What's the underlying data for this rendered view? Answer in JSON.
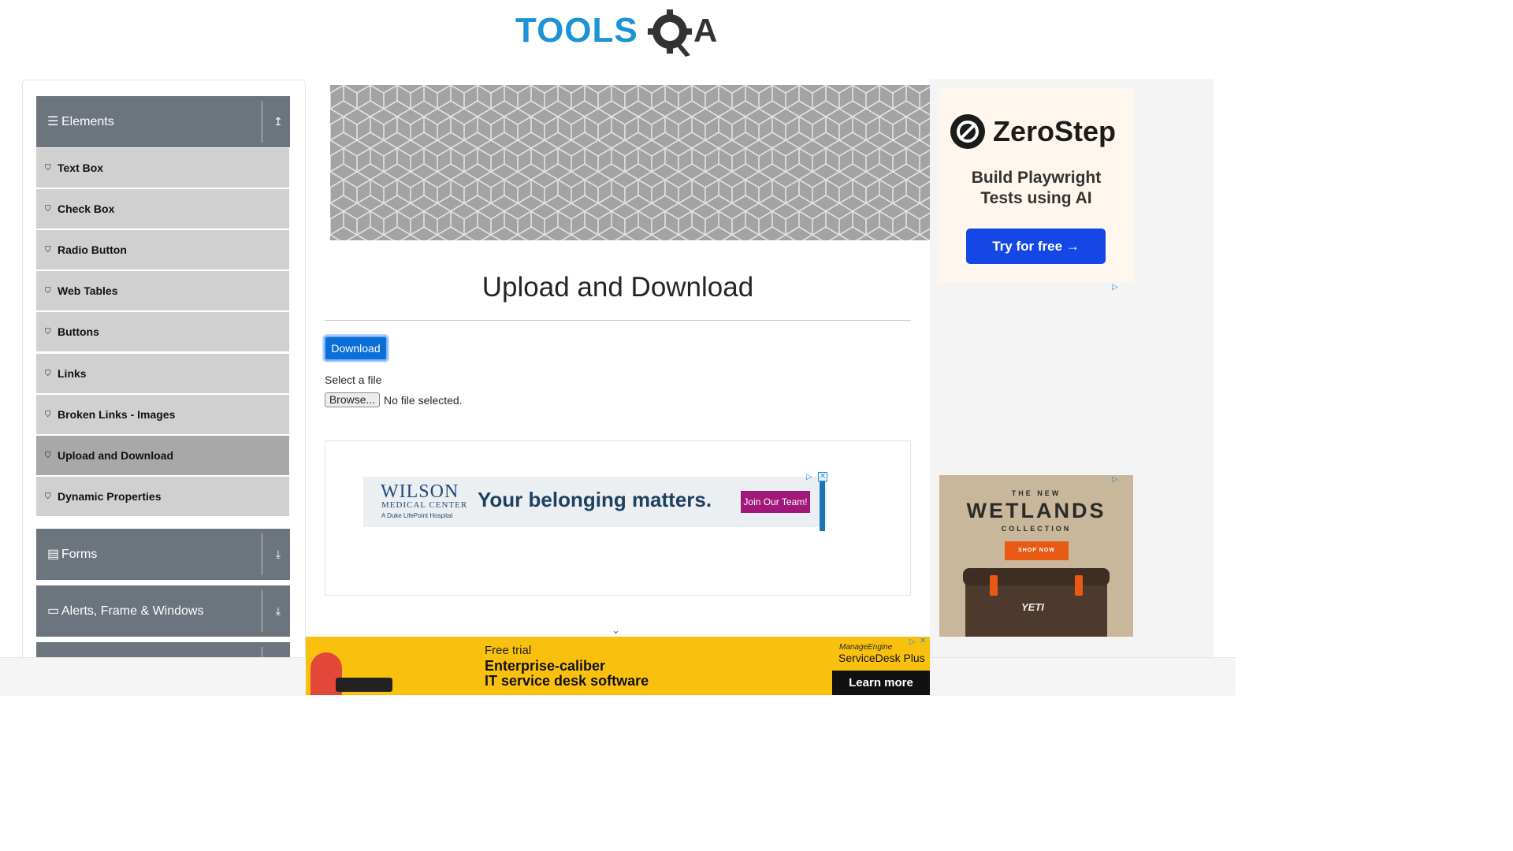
{
  "header": {
    "logo_part1": "TOOLS",
    "logo_part2": "QA"
  },
  "sidebar": {
    "groups": [
      {
        "label": "Elements",
        "toggle": "↥"
      },
      {
        "label": "Forms",
        "toggle": "⤓"
      },
      {
        "label": "Alerts, Frame & Windows",
        "toggle": "⤓"
      }
    ],
    "items": [
      {
        "label": "Text Box"
      },
      {
        "label": "Check Box"
      },
      {
        "label": "Radio Button"
      },
      {
        "label": "Web Tables"
      },
      {
        "label": "Buttons"
      },
      {
        "label": "Links"
      },
      {
        "label": "Broken Links - Images"
      },
      {
        "label": "Upload and Download"
      },
      {
        "label": "Dynamic Properties"
      }
    ],
    "active_item": "Upload and Download"
  },
  "main": {
    "title": "Upload and Download",
    "download_label": "Download",
    "select_label": "Select a file",
    "browse_label": "Browse...",
    "file_status": "No file selected."
  },
  "ads": {
    "wilson": {
      "logo_line1": "WILSON",
      "logo_line2": "MEDICAL CENTER",
      "logo_line3": "A Duke LifePoint Hospital",
      "tagline": "Your belonging matters.",
      "cta": "Join Our Team!"
    },
    "zerostep": {
      "name": "ZeroStep",
      "line1": "Build Playwright",
      "line2": "Tests using AI",
      "cta": "Try for free →"
    },
    "wetlands": {
      "line1": "THE NEW",
      "line2": "WETLANDS",
      "line3": "COLLECTION",
      "cta": "SHOP NOW",
      "brand": "YETI"
    },
    "servicedesk": {
      "line1": "Free trial",
      "line2": "Enterprise-caliber",
      "line3": "IT service desk software",
      "brand1": "ManageEngine",
      "brand2": "ServiceDesk Plus",
      "cta": "Learn more"
    }
  },
  "colors": {
    "accent_blue": "#0a6fd8",
    "logo_blue": "#1a94d2",
    "sidebar_header": "#6c757d",
    "sidebar_item": "#d0d0d0",
    "sidebar_active": "#a8a8a8"
  }
}
